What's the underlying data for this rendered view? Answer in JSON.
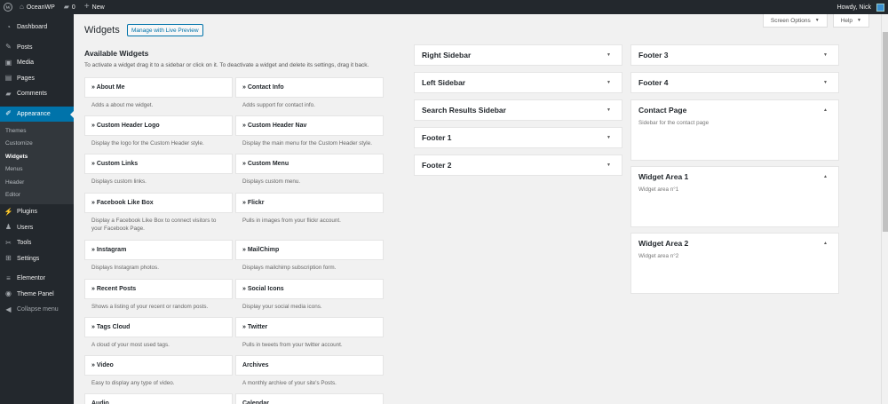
{
  "adminbar": {
    "site_name": "OceanWP",
    "comments_count": "0",
    "new_label": "New",
    "howdy": "Howdy, Nick"
  },
  "sidebar": {
    "items": [
      {
        "label": "Dashboard",
        "icon": "dashboard-icon"
      },
      {
        "label": "Posts",
        "icon": "pin-icon"
      },
      {
        "label": "Media",
        "icon": "media-icon"
      },
      {
        "label": "Pages",
        "icon": "page-icon"
      },
      {
        "label": "Comments",
        "icon": "comment-icon"
      },
      {
        "label": "Appearance",
        "icon": "brush-icon"
      },
      {
        "label": "Plugins",
        "icon": "plug-icon"
      },
      {
        "label": "Users",
        "icon": "user-icon"
      },
      {
        "label": "Tools",
        "icon": "wrench-icon"
      },
      {
        "label": "Settings",
        "icon": "settings-icon"
      },
      {
        "label": "Elementor",
        "icon": "elementor-icon"
      },
      {
        "label": "Theme Panel",
        "icon": "theme-panel-icon"
      },
      {
        "label": "Collapse menu",
        "icon": "collapse-icon"
      }
    ],
    "submenu": [
      "Themes",
      "Customize",
      "Widgets",
      "Menus",
      "Header",
      "Editor"
    ]
  },
  "screen_options": "Screen Options",
  "help": "Help",
  "page_title": "Widgets",
  "live_preview": "Manage with Live Preview",
  "available": {
    "title": "Available Widgets",
    "description": "To activate a widget drag it to a sidebar or click on it. To deactivate a widget and delete its settings, drag it back."
  },
  "widgets_left": [
    {
      "name": "» About Me",
      "desc": "Adds a about me widget."
    },
    {
      "name": "» Custom Header Logo",
      "desc": "Display the logo for the Custom Header style."
    },
    {
      "name": "» Custom Links",
      "desc": "Displays custom links."
    },
    {
      "name": "» Facebook Like Box",
      "desc": "Display a Facebook Like Box to connect visitors to your Facebook Page."
    },
    {
      "name": "» Instagram",
      "desc": "Displays Instagram photos."
    },
    {
      "name": "» Recent Posts",
      "desc": "Shows a listing of your recent or random posts."
    },
    {
      "name": "» Tags Cloud",
      "desc": "A cloud of your most used tags."
    },
    {
      "name": "» Video",
      "desc": "Easy to display any type of video."
    },
    {
      "name": "Audio",
      "desc": ""
    }
  ],
  "widgets_right": [
    {
      "name": "» Contact Info",
      "desc": "Adds support for contact info."
    },
    {
      "name": "» Custom Header Nav",
      "desc": "Display the main menu for the Custom Header style."
    },
    {
      "name": "» Custom Menu",
      "desc": "Displays custom menu."
    },
    {
      "name": "» Flickr",
      "desc": "Pulls in images from your flickr account."
    },
    {
      "name": "» MailChimp",
      "desc": "Displays mailchimp subscription form."
    },
    {
      "name": "» Social Icons",
      "desc": "Display your social media icons."
    },
    {
      "name": "» Twitter",
      "desc": "Pulls in tweets from your twitter account."
    },
    {
      "name": "Archives",
      "desc": "A monthly archive of your site's Posts."
    },
    {
      "name": "Calendar",
      "desc": ""
    }
  ],
  "areas_mid": [
    {
      "name": "Right Sidebar",
      "desc": ""
    },
    {
      "name": "Left Sidebar",
      "desc": ""
    },
    {
      "name": "Search Results Sidebar",
      "desc": ""
    },
    {
      "name": "Footer 1",
      "desc": ""
    },
    {
      "name": "Footer 2",
      "desc": ""
    }
  ],
  "areas_right": [
    {
      "name": "Footer 3",
      "desc": ""
    },
    {
      "name": "Footer 4",
      "desc": ""
    },
    {
      "name": "Contact Page",
      "desc": "Sidebar for the contact page"
    },
    {
      "name": "Widget Area 1",
      "desc": "Widget area n°1"
    },
    {
      "name": "Widget Area 2",
      "desc": "Widget area n°2"
    }
  ],
  "colors": {
    "accent": "#0073aa",
    "adminbar": "#23282d",
    "background": "#f1f1f1"
  }
}
